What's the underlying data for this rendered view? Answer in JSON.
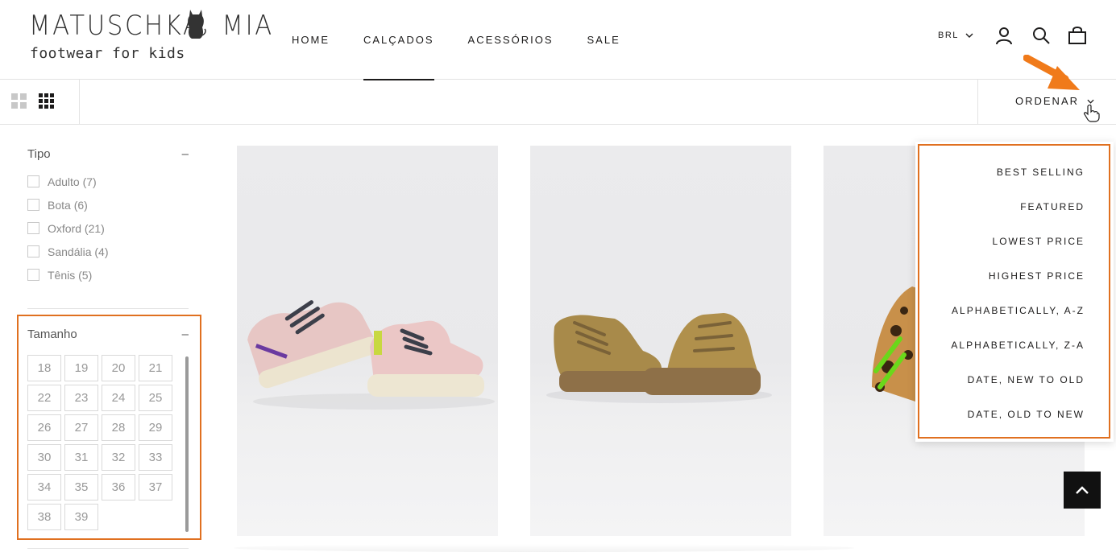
{
  "brand": {
    "logo_top": "MATUSCHKA MIA",
    "logo_bottom": "footwear for kids"
  },
  "nav": {
    "items": [
      {
        "label": "HOME"
      },
      {
        "label": "CALÇADOS",
        "active": true
      },
      {
        "label": "ACESSÓRIOS"
      },
      {
        "label": "SALE"
      }
    ]
  },
  "header": {
    "currency": "BRL",
    "icons": [
      "account-icon",
      "search-icon",
      "cart-icon"
    ]
  },
  "toolbar": {
    "view_icons": [
      "grid-2-icon",
      "grid-3-icon"
    ],
    "sort_label": "ORDENAR"
  },
  "filters": {
    "tipo": {
      "title": "Tipo",
      "toggle": "–",
      "options": [
        {
          "label": "Adulto (7)"
        },
        {
          "label": "Bota (6)"
        },
        {
          "label": "Oxford (21)"
        },
        {
          "label": "Sandália (4)"
        },
        {
          "label": "Tênis (5)"
        }
      ]
    },
    "tamanho": {
      "title": "Tamanho",
      "toggle": "–",
      "sizes": [
        "18",
        "19",
        "20",
        "21",
        "22",
        "23",
        "24",
        "25",
        "26",
        "27",
        "28",
        "29",
        "30",
        "31",
        "32",
        "33",
        "34",
        "35",
        "36",
        "37",
        "38",
        "39"
      ]
    }
  },
  "sort_options": [
    "BEST SELLING",
    "FEATURED",
    "LOWEST PRICE",
    "HIGHEST PRICE",
    "ALPHABETICALLY, A-Z",
    "ALPHABETICALLY, Z-A",
    "DATE, NEW TO OLD",
    "DATE, OLD TO NEW"
  ],
  "colors": {
    "highlight": "#e07020",
    "text": "#1c1b1b",
    "muted": "#888888",
    "border": "#e3e3e3"
  }
}
